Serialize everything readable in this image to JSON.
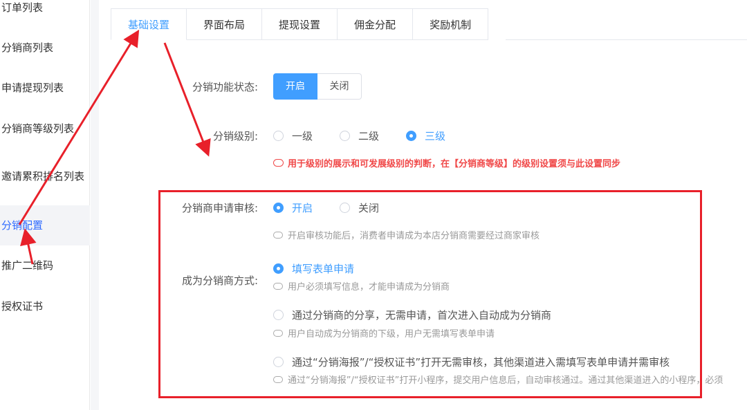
{
  "sidebar": {
    "items": [
      {
        "label": "订单列表"
      },
      {
        "label": "分销商列表"
      },
      {
        "label": "申请提现列表"
      },
      {
        "label": "分销商等级列表"
      },
      {
        "label": "邀请累积排名列表"
      },
      {
        "label": "分销配置"
      },
      {
        "label": "推广二维码"
      },
      {
        "label": "授权证书"
      }
    ]
  },
  "tabs": [
    {
      "label": "基础设置"
    },
    {
      "label": "界面布局"
    },
    {
      "label": "提现设置"
    },
    {
      "label": "佣金分配"
    },
    {
      "label": "奖励机制"
    }
  ],
  "form": {
    "status": {
      "label": "分销功能状态:",
      "on": "开启",
      "off": "关闭"
    },
    "level": {
      "label": "分销级别:",
      "options": [
        "一级",
        "二级",
        "三级"
      ],
      "selected": "三级",
      "warning": "用于级别的展示和可发展级别的判断，在【分销商等级】的级别设置须与此设置同步"
    },
    "audit": {
      "label": "分销商申请审核:",
      "on": "开启",
      "off": "关闭",
      "selected": "开启",
      "hint": "开启审核功能后，消费者申请成为本店分销商需要经过商家审核"
    },
    "become": {
      "label": "成为分销商方式:",
      "options": [
        {
          "label": "填写表单申请",
          "hint": "用户必须填写信息，才能申请成为分销商"
        },
        {
          "label": "通过分销商的分享，无需申请，首次进入自动成为分销商",
          "hint": "用户自动成为分销商的下级，用户无需填写表单申请"
        },
        {
          "label": "通过“分销海报”/“授权证书”打开无需审核，其他渠道进入需填写表单申请并需审核",
          "hint": "通过“分销海报”/“授权证书”打开小程序，提交用户信息后，自动审核通过。通过其他渠道进入的小程序，必须"
        }
      ],
      "selected": "填写表单申请"
    }
  },
  "colors": {
    "accent": "#409eff",
    "annotation": "#e8202a",
    "warning": "#f04848"
  }
}
